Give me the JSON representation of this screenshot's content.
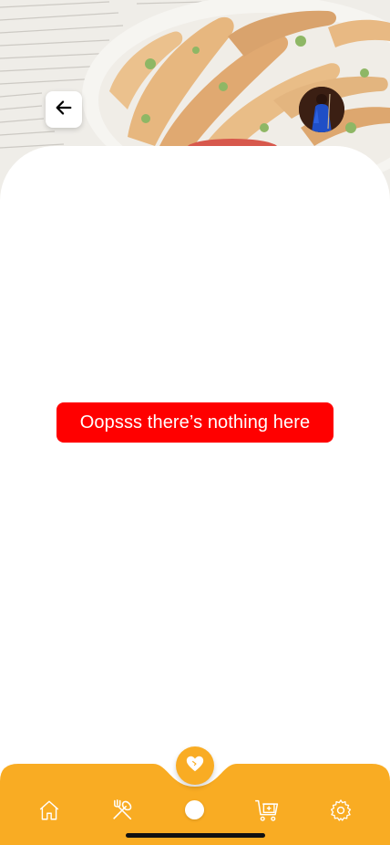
{
  "header": {
    "back_button_icon": "arrow-left-icon",
    "avatar_icon": "user-avatar"
  },
  "main": {
    "empty_message": "Oopsss there’s nothing here"
  },
  "tabbar": {
    "items": [
      {
        "id": "home",
        "icon": "home-icon"
      },
      {
        "id": "recipes",
        "icon": "utensils-icon"
      },
      {
        "id": "favorites",
        "icon": "heart-icon",
        "active": true
      },
      {
        "id": "cart",
        "icon": "cart-plus-icon"
      },
      {
        "id": "settings",
        "icon": "gear-icon"
      }
    ]
  },
  "colors": {
    "accent": "#f9ac23",
    "alert": "#ff0000",
    "background": "#ffffff"
  }
}
